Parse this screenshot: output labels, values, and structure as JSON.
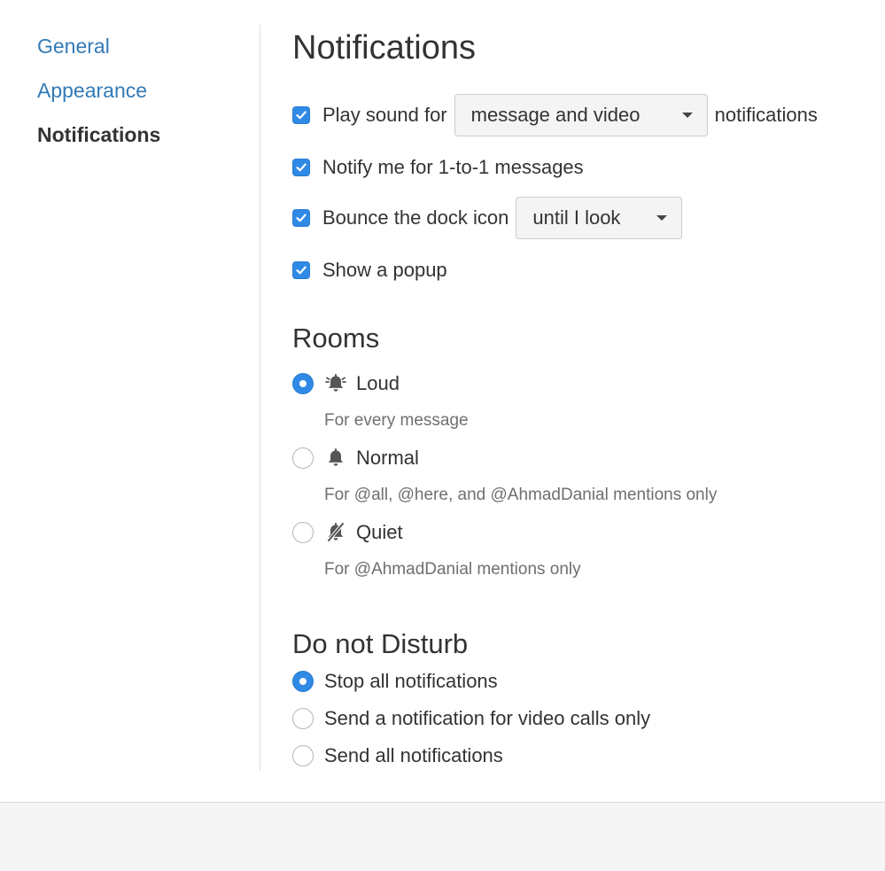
{
  "sidebar": {
    "items": [
      {
        "label": "General"
      },
      {
        "label": "Appearance"
      },
      {
        "label": "Notifications"
      }
    ]
  },
  "notifications": {
    "title": "Notifications",
    "play_sound": {
      "prefix": "Play sound for",
      "selected": "message and video",
      "suffix": "notifications",
      "checked": true
    },
    "notify_one_to_one": {
      "label": "Notify me for 1-to-1 messages",
      "checked": true
    },
    "bounce_dock": {
      "prefix": "Bounce the dock icon",
      "selected": "until I look",
      "checked": true
    },
    "show_popup": {
      "label": "Show a popup",
      "checked": true
    }
  },
  "rooms": {
    "title": "Rooms",
    "options": [
      {
        "label": "Loud",
        "description": "For every message",
        "icon": "bell-ringing-icon",
        "selected": true
      },
      {
        "label": "Normal",
        "description": "For @all, @here, and @AhmadDanial mentions only",
        "icon": "bell-icon",
        "selected": false
      },
      {
        "label": "Quiet",
        "description": "For @AhmadDanial mentions only",
        "icon": "bell-muted-icon",
        "selected": false
      }
    ]
  },
  "do_not_disturb": {
    "title": "Do not Disturb",
    "options": [
      {
        "label": "Stop all notifications",
        "selected": true
      },
      {
        "label": "Send a notification for video calls only",
        "selected": false
      },
      {
        "label": "Send all notifications",
        "selected": false
      }
    ]
  },
  "colors": {
    "accent": "#2f8ae6",
    "link": "#337ab7",
    "muted_text": "#6f6f6f"
  }
}
